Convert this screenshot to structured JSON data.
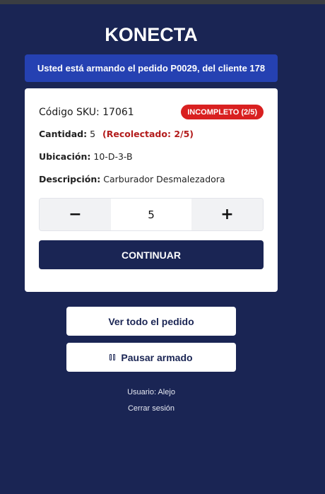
{
  "app": {
    "title": "KONECTA"
  },
  "banner": {
    "prefix": "Usted está armando el pedido ",
    "order_id": "P0029",
    "middle": ", del cliente ",
    "client_id": "178"
  },
  "item": {
    "sku_label": "Código SKU: 17061",
    "status": "INCOMPLETO (2/5)",
    "quantity_key": "Cantidad:",
    "quantity_value": "5",
    "collected": "(Recolectado: 2/5)",
    "location_key": "Ubicación:",
    "location_value": "10-D-3-B",
    "description_key": "Descripción:",
    "description_value": "Carburador Desmalezadora"
  },
  "stepper": {
    "minus": "−",
    "value": "5",
    "plus": "+"
  },
  "actions": {
    "continue": "CONTINUAR",
    "view_order": "Ver todo el pedido",
    "pause": "Pausar armado"
  },
  "footer": {
    "user": "Usuario: Alejo",
    "logout": "Cerrar sesión"
  },
  "colors": {
    "background": "#1a2554",
    "banner": "#2541b2",
    "badge": "#d92020",
    "collected": "#b31c1c"
  }
}
